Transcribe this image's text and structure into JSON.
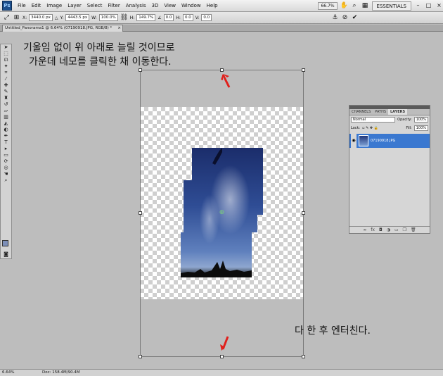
{
  "menubar": {
    "logo": "Ps",
    "items": [
      "File",
      "Edit",
      "Image",
      "Layer",
      "Select",
      "Filter",
      "Analysis",
      "3D",
      "View",
      "Window",
      "Help"
    ],
    "zoom": "66.7%",
    "workspace": "ESSENTIALS",
    "win_controls": [
      "–",
      "□",
      "×"
    ]
  },
  "options": {
    "x_label": "X:",
    "x_value": "3440.0 px",
    "y_label": "Y:",
    "y_value": "4443.5 px",
    "w_label": "W:",
    "w_value": "100.0%",
    "h_label": "H:",
    "h_value": "149.7%",
    "angle_value": "0.0",
    "hskew_label": "H:",
    "hskew_value": "0.0",
    "vskew_label": "V:",
    "vskew_value": "0.0"
  },
  "document": {
    "tab_title": "Untitled_Panorama1 @ 6.64% (07190918.JPG, RGB/8) *",
    "close_glyph": "×"
  },
  "annotations": {
    "line1": "기울임 없이 위 아래로 늘릴 것이므로",
    "line2": "가운데 네모를 클릭한 채 이동한다.",
    "line3": "다 한 후 엔터친다."
  },
  "layers_panel": {
    "tabs": [
      "CHANNELS",
      "PATHS",
      "LAYERS"
    ],
    "active_tab": "LAYERS",
    "blend_mode": "Normal",
    "opacity_label": "Opacity:",
    "opacity_value": "100%",
    "lock_label": "Lock:",
    "fill_label": "Fill:",
    "fill_value": "100%",
    "layer_name": "07190918.JPG"
  },
  "status": {
    "zoom": "6.64%",
    "doc": "Doc: 158.4M/90.4M"
  },
  "colors": {
    "canvas_bg": "#bdbdbd",
    "selection": "#3a78d0",
    "arrow": "#e0201c",
    "foreground_swatch": "#7d8fb8"
  }
}
